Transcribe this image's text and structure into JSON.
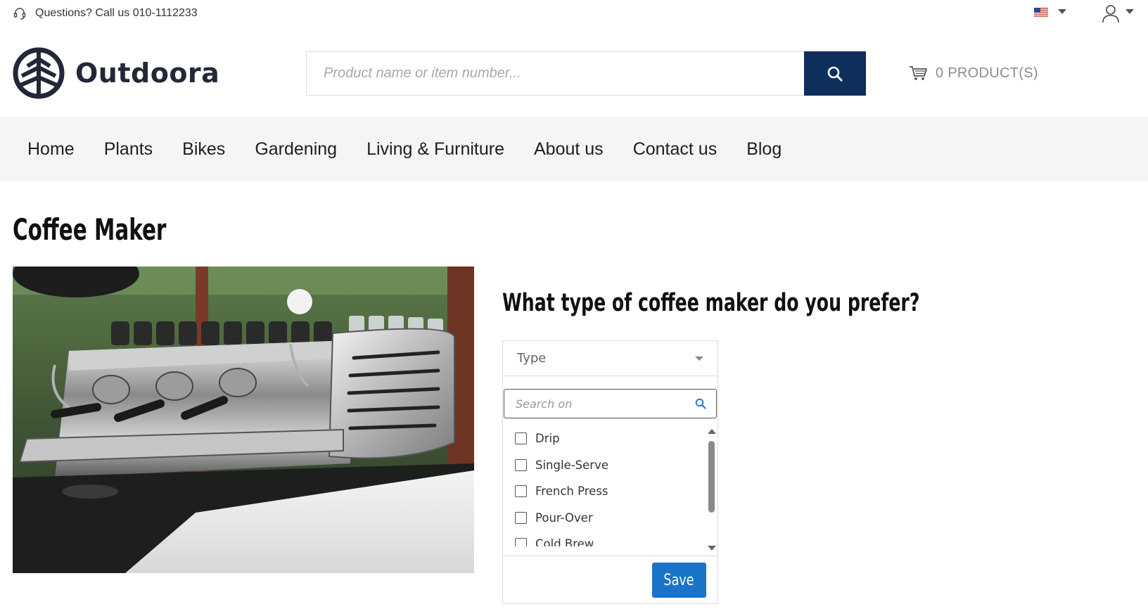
{
  "topbar": {
    "phone_text": "Questions? Call us 010-1112233"
  },
  "header": {
    "brand": "Outdoora",
    "search_placeholder": "Product name or item number...",
    "cart_label": "0 PRODUCT(S)"
  },
  "nav": {
    "items": [
      {
        "label": "Home"
      },
      {
        "label": "Plants"
      },
      {
        "label": "Bikes"
      },
      {
        "label": "Gardening"
      },
      {
        "label": "Living & Furniture"
      },
      {
        "label": "About us"
      },
      {
        "label": "Contact us"
      },
      {
        "label": "Blog"
      }
    ]
  },
  "page": {
    "title": "Coffee Maker",
    "question": "What type of coffee maker do you prefer?"
  },
  "dropdown": {
    "selected_label": "Type",
    "search_placeholder": "Search on",
    "options": [
      {
        "label": "Drip",
        "checked": false
      },
      {
        "label": "Single-Serve",
        "checked": false
      },
      {
        "label": "French Press",
        "checked": false
      },
      {
        "label": "Pour-Over",
        "checked": false
      },
      {
        "label": "Cold Brew",
        "checked": false
      }
    ],
    "save_label": "Save"
  },
  "colors": {
    "search_button": "#0d2f5a",
    "save_button": "#1a73c8",
    "nav_background": "#f5f5f5",
    "brand": "#232838"
  },
  "icons": {
    "phone": "headset-icon",
    "flag": "us-flag-icon",
    "user": "user-icon",
    "search": "search-icon",
    "cart": "cart-icon"
  }
}
